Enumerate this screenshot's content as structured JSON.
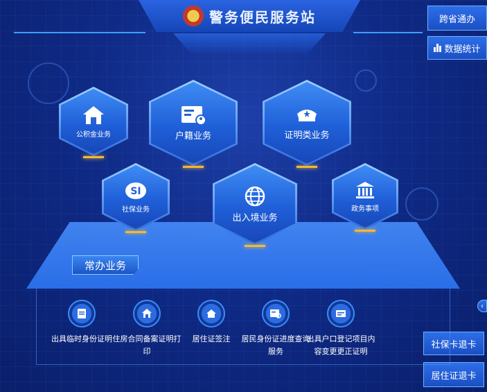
{
  "header": {
    "title": "警务便民服务站"
  },
  "side_buttons": {
    "cross_province": "跨省通办",
    "statistics": "数据统计",
    "social_card_refund": "社保卡退卡",
    "residence_card_refund": "居住证退卡"
  },
  "hex_services": [
    {
      "label": "公积金业务",
      "icon": "house-icon"
    },
    {
      "label": "户籍业务",
      "icon": "id-card-icon"
    },
    {
      "label": "证明类业务",
      "icon": "police-cap-icon"
    },
    {
      "label": "社保业务",
      "icon": "social-security-icon"
    },
    {
      "label": "出入境业务",
      "icon": "globe-icon"
    },
    {
      "label": "政务事项",
      "icon": "government-building-icon"
    }
  ],
  "common": {
    "title": "常办业务",
    "items": [
      {
        "label": "出具临时身份证明",
        "icon": "document-icon"
      },
      {
        "label": "住房合同备案证明打印",
        "icon": "house-print-icon"
      },
      {
        "label": "居住证签注",
        "icon": "house-stamp-icon"
      },
      {
        "label": "居民身份证进度查询服务",
        "icon": "id-search-icon"
      },
      {
        "label": "出具户口登记项目内容变更更正证明",
        "icon": "certificate-icon"
      }
    ]
  },
  "colors": {
    "accent": "#2a6ee8",
    "gold": "#f0b93a",
    "background": "#0f2a86"
  }
}
